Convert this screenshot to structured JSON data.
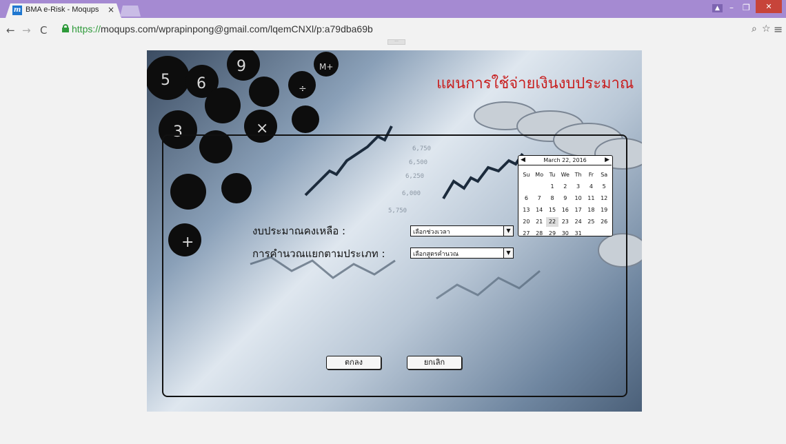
{
  "browser": {
    "tab_title": "BMA e-Risk - Moqups",
    "tab_favicon": "m",
    "tab_close": "×",
    "url_scheme": "https://",
    "url_rest": "moqups.com/wprapinpong@gmail.com/lqemCNXl/p:a79dba69b",
    "icons": [
      "back-icon",
      "forward-icon",
      "reload-icon",
      "lock-icon",
      "zoom-icon",
      "star-icon",
      "menu-icon"
    ],
    "colors": {
      "titlebar": "#a58ad2",
      "close": "#c7443a",
      "secure": "#2e9a3a"
    }
  },
  "mockup": {
    "title": "แผนการใช้จ่ายเงินงบประมาณ",
    "title_color": "#c81e1e",
    "form": {
      "budget_label": "งบประมาณคงเหลือ :",
      "budget_select": "เลือกช่วงเวลา",
      "calc_label": "การคำนวณแยกตามประเภท :",
      "calc_select": "เลือกสูตรคำนวณ"
    },
    "calendar": {
      "title": "March 22, 2016",
      "weekdays": [
        "Su",
        "Mo",
        "Tu",
        "We",
        "Th",
        "Fr",
        "Sa"
      ],
      "selected_day": "22",
      "days": [
        "",
        "",
        "1",
        "2",
        "3",
        "4",
        "5",
        "6",
        "7",
        "8",
        "9",
        "10",
        "11",
        "12",
        "13",
        "14",
        "15",
        "16",
        "17",
        "18",
        "19",
        "20",
        "21",
        "22",
        "23",
        "24",
        "25",
        "26",
        "27",
        "28",
        "29",
        "30",
        "31",
        "",
        ""
      ]
    },
    "buttons": {
      "ok": "ตกลง",
      "cancel": "ยกเลิก"
    }
  }
}
